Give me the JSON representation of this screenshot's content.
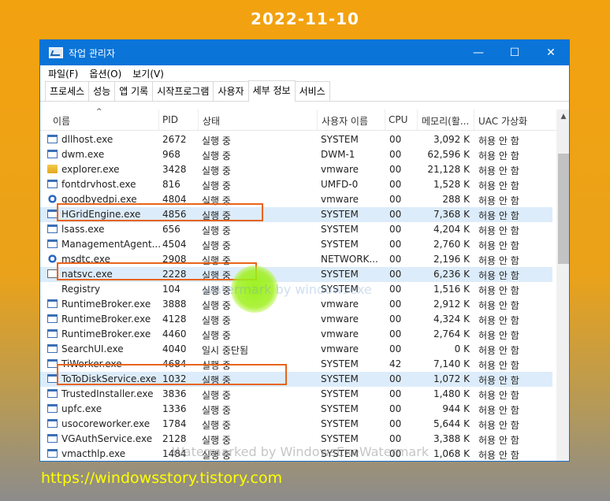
{
  "date": "2022-11-10",
  "url": "https://windowsstory.tistory.com",
  "window": {
    "title": "작업 관리자",
    "controls": {
      "minimize": "—",
      "maximize": "☐",
      "close": "✕"
    }
  },
  "menu": [
    "파일(F)",
    "옵션(O)",
    "보기(V)"
  ],
  "tabs": [
    "프로세스",
    "성능",
    "앱 기록",
    "시작프로그램",
    "사용자",
    "세부 정보",
    "서비스"
  ],
  "active_tab": "세부 정보",
  "columns": {
    "name": "이름",
    "pid": "PID",
    "status": "상태",
    "user": "사용자 이름",
    "cpu": "CPU",
    "mem": "메모리(활...",
    "uac": "UAC 가상화"
  },
  "rows": [
    {
      "icon": "app-icon",
      "name": "dllhost.exe",
      "pid": "2672",
      "status": "실행 중",
      "user": "SYSTEM",
      "cpu": "00",
      "mem": "3,092 K",
      "uac": "허용 안 함"
    },
    {
      "icon": "app-icon",
      "name": "dwm.exe",
      "pid": "968",
      "status": "실행 중",
      "user": "DWM-1",
      "cpu": "00",
      "mem": "62,596 K",
      "uac": "허용 안 함"
    },
    {
      "icon": "folder-icon",
      "name": "explorer.exe",
      "pid": "3428",
      "status": "실행 중",
      "user": "vmware",
      "cpu": "00",
      "mem": "21,128 K",
      "uac": "허용 안 함"
    },
    {
      "icon": "app-icon",
      "name": "fontdrvhost.exe",
      "pid": "816",
      "status": "실행 중",
      "user": "UMFD-0",
      "cpu": "00",
      "mem": "1,528 K",
      "uac": "허용 안 함"
    },
    {
      "icon": "gear-icon",
      "name": "goodbyedpi.exe",
      "pid": "4804",
      "status": "실행 중",
      "user": "vmware",
      "cpu": "00",
      "mem": "288 K",
      "uac": "허용 안 함"
    },
    {
      "icon": "app-icon",
      "name": "HGridEngine.exe",
      "pid": "4856",
      "status": "실행 중",
      "user": "SYSTEM",
      "cpu": "00",
      "mem": "7,368 K",
      "uac": "허용 안 함"
    },
    {
      "icon": "app-icon",
      "name": "lsass.exe",
      "pid": "656",
      "status": "실행 중",
      "user": "SYSTEM",
      "cpu": "00",
      "mem": "4,204 K",
      "uac": "허용 안 함"
    },
    {
      "icon": "app-icon",
      "name": "ManagementAgent...",
      "pid": "4504",
      "status": "실행 중",
      "user": "SYSTEM",
      "cpu": "00",
      "mem": "2,760 K",
      "uac": "허용 안 함"
    },
    {
      "icon": "gear-icon",
      "name": "msdtc.exe",
      "pid": "2908",
      "status": "실행 중",
      "user": "NETWORK...",
      "cpu": "00",
      "mem": "2,196 K",
      "uac": "허용 안 함"
    },
    {
      "icon": "white-icon",
      "name": "natsvc.exe",
      "pid": "2228",
      "status": "실행 중",
      "user": "SYSTEM",
      "cpu": "00",
      "mem": "6,236 K",
      "uac": "허용 안 함"
    },
    {
      "icon": "none",
      "name": "Registry",
      "pid": "104",
      "status": "실행 중",
      "user": "SYSTEM",
      "cpu": "00",
      "mem": "1,516 K",
      "uac": "허용 안 함"
    },
    {
      "icon": "app-icon",
      "name": "RuntimeBroker.exe",
      "pid": "3888",
      "status": "실행 중",
      "user": "vmware",
      "cpu": "00",
      "mem": "2,912 K",
      "uac": "허용 안 함"
    },
    {
      "icon": "app-icon",
      "name": "RuntimeBroker.exe",
      "pid": "4128",
      "status": "실행 중",
      "user": "vmware",
      "cpu": "00",
      "mem": "4,324 K",
      "uac": "허용 안 함"
    },
    {
      "icon": "app-icon",
      "name": "RuntimeBroker.exe",
      "pid": "4460",
      "status": "실행 중",
      "user": "vmware",
      "cpu": "00",
      "mem": "2,764 K",
      "uac": "허용 안 함"
    },
    {
      "icon": "app-icon",
      "name": "SearchUI.exe",
      "pid": "4040",
      "status": "일시 중단됨",
      "user": "vmware",
      "cpu": "00",
      "mem": "0 K",
      "uac": "허용 안 함"
    },
    {
      "icon": "app-icon",
      "name": "TiWorker.exe",
      "pid": "4684",
      "status": "실행 중",
      "user": "SYSTEM",
      "cpu": "42",
      "mem": "7,140 K",
      "uac": "허용 안 함"
    },
    {
      "icon": "app-icon",
      "name": "ToToDiskService.exe",
      "pid": "1032",
      "status": "실행 중",
      "user": "SYSTEM",
      "cpu": "00",
      "mem": "1,072 K",
      "uac": "허용 안 함"
    },
    {
      "icon": "app-icon",
      "name": "TrustedInstaller.exe",
      "pid": "3836",
      "status": "실행 중",
      "user": "SYSTEM",
      "cpu": "00",
      "mem": "1,480 K",
      "uac": "허용 안 함"
    },
    {
      "icon": "app-icon",
      "name": "upfc.exe",
      "pid": "1336",
      "status": "실행 중",
      "user": "SYSTEM",
      "cpu": "00",
      "mem": "944 K",
      "uac": "허용 안 함"
    },
    {
      "icon": "app-icon",
      "name": "usocoreworker.exe",
      "pid": "1784",
      "status": "실행 중",
      "user": "SYSTEM",
      "cpu": "00",
      "mem": "5,644 K",
      "uac": "허용 안 함"
    },
    {
      "icon": "app-icon",
      "name": "VGAuthService.exe",
      "pid": "2128",
      "status": "실행 중",
      "user": "SYSTEM",
      "cpu": "00",
      "mem": "3,388 K",
      "uac": "허용 안 함"
    },
    {
      "icon": "app-icon",
      "name": "vmacthlp.exe",
      "pid": "1484",
      "status": "실행 중",
      "user": "SYSTEM",
      "cpu": "00",
      "mem": "1,068 K",
      "uac": "허용 안 함"
    }
  ],
  "highlighted_rows": [
    "HGridEngine.exe",
    "natsvc.exe",
    "ToToDiskService.exe"
  ],
  "watermarks": [
    "Watermarked by WindowsExeWatermark",
    "watermark by windowsexe"
  ],
  "colors": {
    "titlebar": "#0a74d8",
    "highlight_box": "#e8641a",
    "selected_row": "#cce4f7",
    "cursor_glow": "#9ef01a",
    "url": "#ffff00"
  }
}
